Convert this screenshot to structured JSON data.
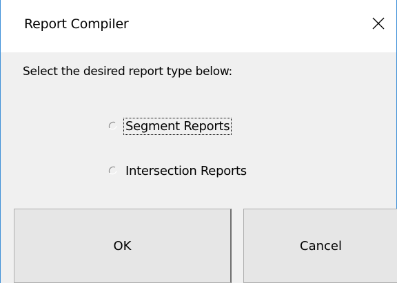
{
  "dialog": {
    "title": "Report Compiler",
    "close_icon": "close-icon",
    "prompt": "Select the desired report type below:",
    "options": [
      {
        "label": "Segment Reports",
        "selected": false,
        "focused": true
      },
      {
        "label": "Intersection Reports",
        "selected": false,
        "focused": false
      }
    ],
    "buttons": {
      "ok_label": "OK",
      "cancel_label": "Cancel"
    }
  },
  "colors": {
    "dialog_bg": "#f0f0f0",
    "titlebar_bg": "#ffffff",
    "window_border": "#3c8fd8",
    "button_bg": "#e6e6e6",
    "button_border": "#adadad"
  }
}
